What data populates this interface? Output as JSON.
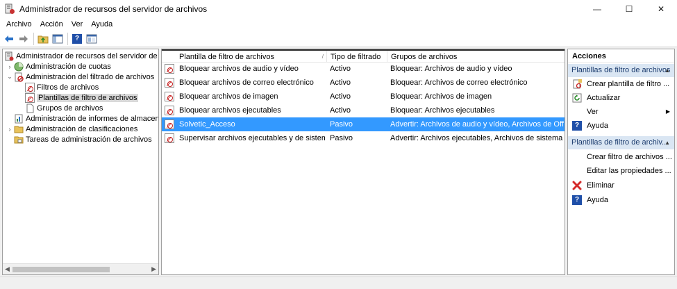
{
  "window": {
    "title": "Administrador de recursos del servidor de archivos",
    "controls": [
      "—",
      "☐",
      "✕"
    ]
  },
  "menu": [
    "Archivo",
    "Acción",
    "Ver",
    "Ayuda"
  ],
  "toolbar": {
    "buttons": [
      "back-icon",
      "forward-icon",
      "up-folder-icon",
      "show-hide-tree-icon",
      "help-icon",
      "properties-icon"
    ]
  },
  "tree": [
    {
      "label": "Administrador de recursos del servidor de arch",
      "level": 0,
      "arrow": "",
      "icon": "server-icon"
    },
    {
      "label": "Administración de cuotas",
      "level": 1,
      "arrow": "›",
      "icon": "quota-icon"
    },
    {
      "label": "Administración del filtrado de archivos",
      "level": 1,
      "arrow": "⌄",
      "icon": "file-screen-icon"
    },
    {
      "label": "Filtros de archivos",
      "level": 2,
      "arrow": "",
      "icon": "file-screen-doc-icon"
    },
    {
      "label": "Plantillas de filtro de archivos",
      "level": 2,
      "arrow": "",
      "icon": "file-screen-doc-icon",
      "selected": true
    },
    {
      "label": "Grupos de archivos",
      "level": 2,
      "arrow": "",
      "icon": "page-icon"
    },
    {
      "label": "Administración de informes de almacenam",
      "level": 1,
      "arrow": "",
      "icon": "reports-icon"
    },
    {
      "label": "Administración de clasificaciones",
      "level": 1,
      "arrow": "›",
      "icon": "classification-icon"
    },
    {
      "label": "Tareas de administración de archivos",
      "level": 1,
      "arrow": "",
      "icon": "tasks-icon"
    }
  ],
  "table": {
    "columns": [
      "Plantilla de filtro de archivos",
      "Tipo de filtrado",
      "Grupos de archivos"
    ],
    "rows": [
      {
        "name": "Bloquear archivos de audio y vídeo",
        "type": "Activo",
        "groups": "Bloquear: Archivos de audio y vídeo"
      },
      {
        "name": "Bloquear archivos de correo electrónico",
        "type": "Activo",
        "groups": "Bloquear: Archivos de correo electrónico"
      },
      {
        "name": "Bloquear archivos de imagen",
        "type": "Activo",
        "groups": "Bloquear: Archivos de imagen"
      },
      {
        "name": "Bloquear archivos ejecutables",
        "type": "Activo",
        "groups": "Bloquear: Archivos ejecutables"
      },
      {
        "name": "Solvetic_Acceso",
        "type": "Pasivo",
        "groups": "Advertir: Archivos de audio y vídeo, Archivos de Office...",
        "selected": true
      },
      {
        "name": "Supervisar archivos ejecutables y de sistema",
        "type": "Pasivo",
        "groups": "Advertir: Archivos ejecutables, Archivos de sistema"
      }
    ]
  },
  "actions": {
    "title": "Acciones",
    "sections": [
      {
        "header": "Plantillas de filtro de archivos",
        "items": [
          {
            "label": "Crear plantilla de filtro ...",
            "icon": "new-template-icon"
          },
          {
            "label": "Actualizar",
            "icon": "refresh-icon"
          },
          {
            "label": "Ver",
            "icon": "",
            "submenu": true
          },
          {
            "label": "Ayuda",
            "icon": "help-icon"
          }
        ]
      },
      {
        "header": "Plantillas de filtro de archiv...",
        "items": [
          {
            "label": "Crear filtro de archivos ...",
            "icon": ""
          },
          {
            "label": "Editar las propiedades ...",
            "icon": ""
          },
          {
            "label": "Eliminar",
            "icon": "delete-icon"
          },
          {
            "label": "Ayuda",
            "icon": "help-icon"
          }
        ]
      }
    ]
  },
  "colors": {
    "selection": "#3399ff",
    "section_header_bg": "#dae6f3",
    "delete_red": "#d42a2a",
    "help_blue": "#1f4fa8"
  }
}
